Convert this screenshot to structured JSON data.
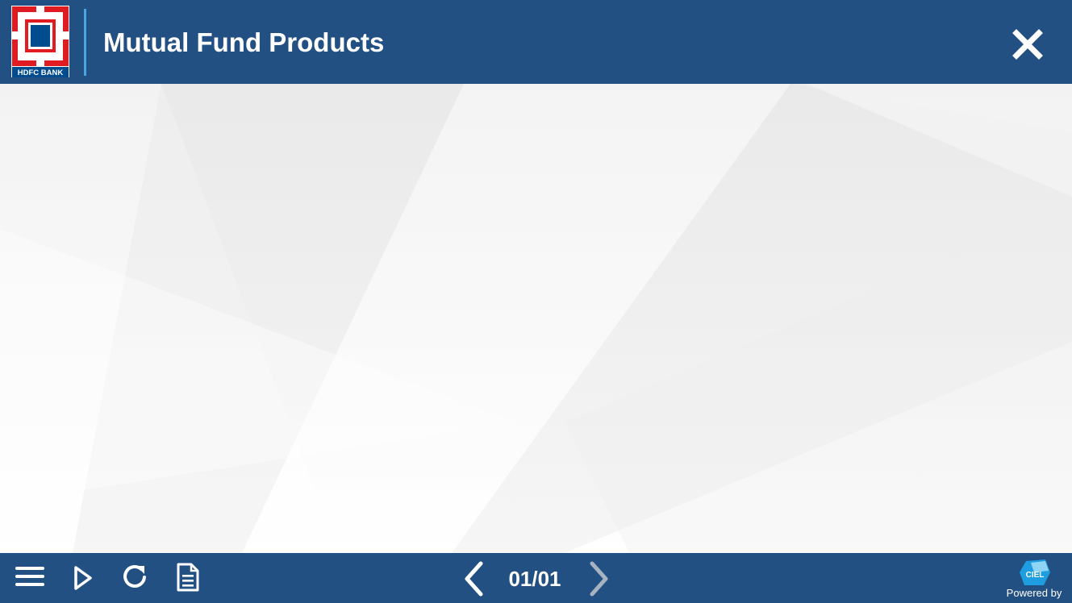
{
  "header": {
    "logo_text": "HDFC BANK",
    "title": "Mutual Fund Products",
    "close_icon": "close-icon"
  },
  "footer": {
    "menu_icon": "hamburger-menu-icon",
    "play_icon": "play-icon",
    "replay_icon": "replay-icon",
    "notes_icon": "document-icon",
    "prev_icon": "chevron-left-icon",
    "next_icon": "chevron-right-icon",
    "page_counter": "01/01",
    "powered_by": "Powered by",
    "powered_logo_text": "CIEL"
  },
  "colors": {
    "bar_blue": "#235082",
    "accent_blue": "#4aa6e0",
    "logo_red": "#e11b22",
    "logo_navy": "#004c8f",
    "disabled_arrow": "#a7b3c2"
  }
}
